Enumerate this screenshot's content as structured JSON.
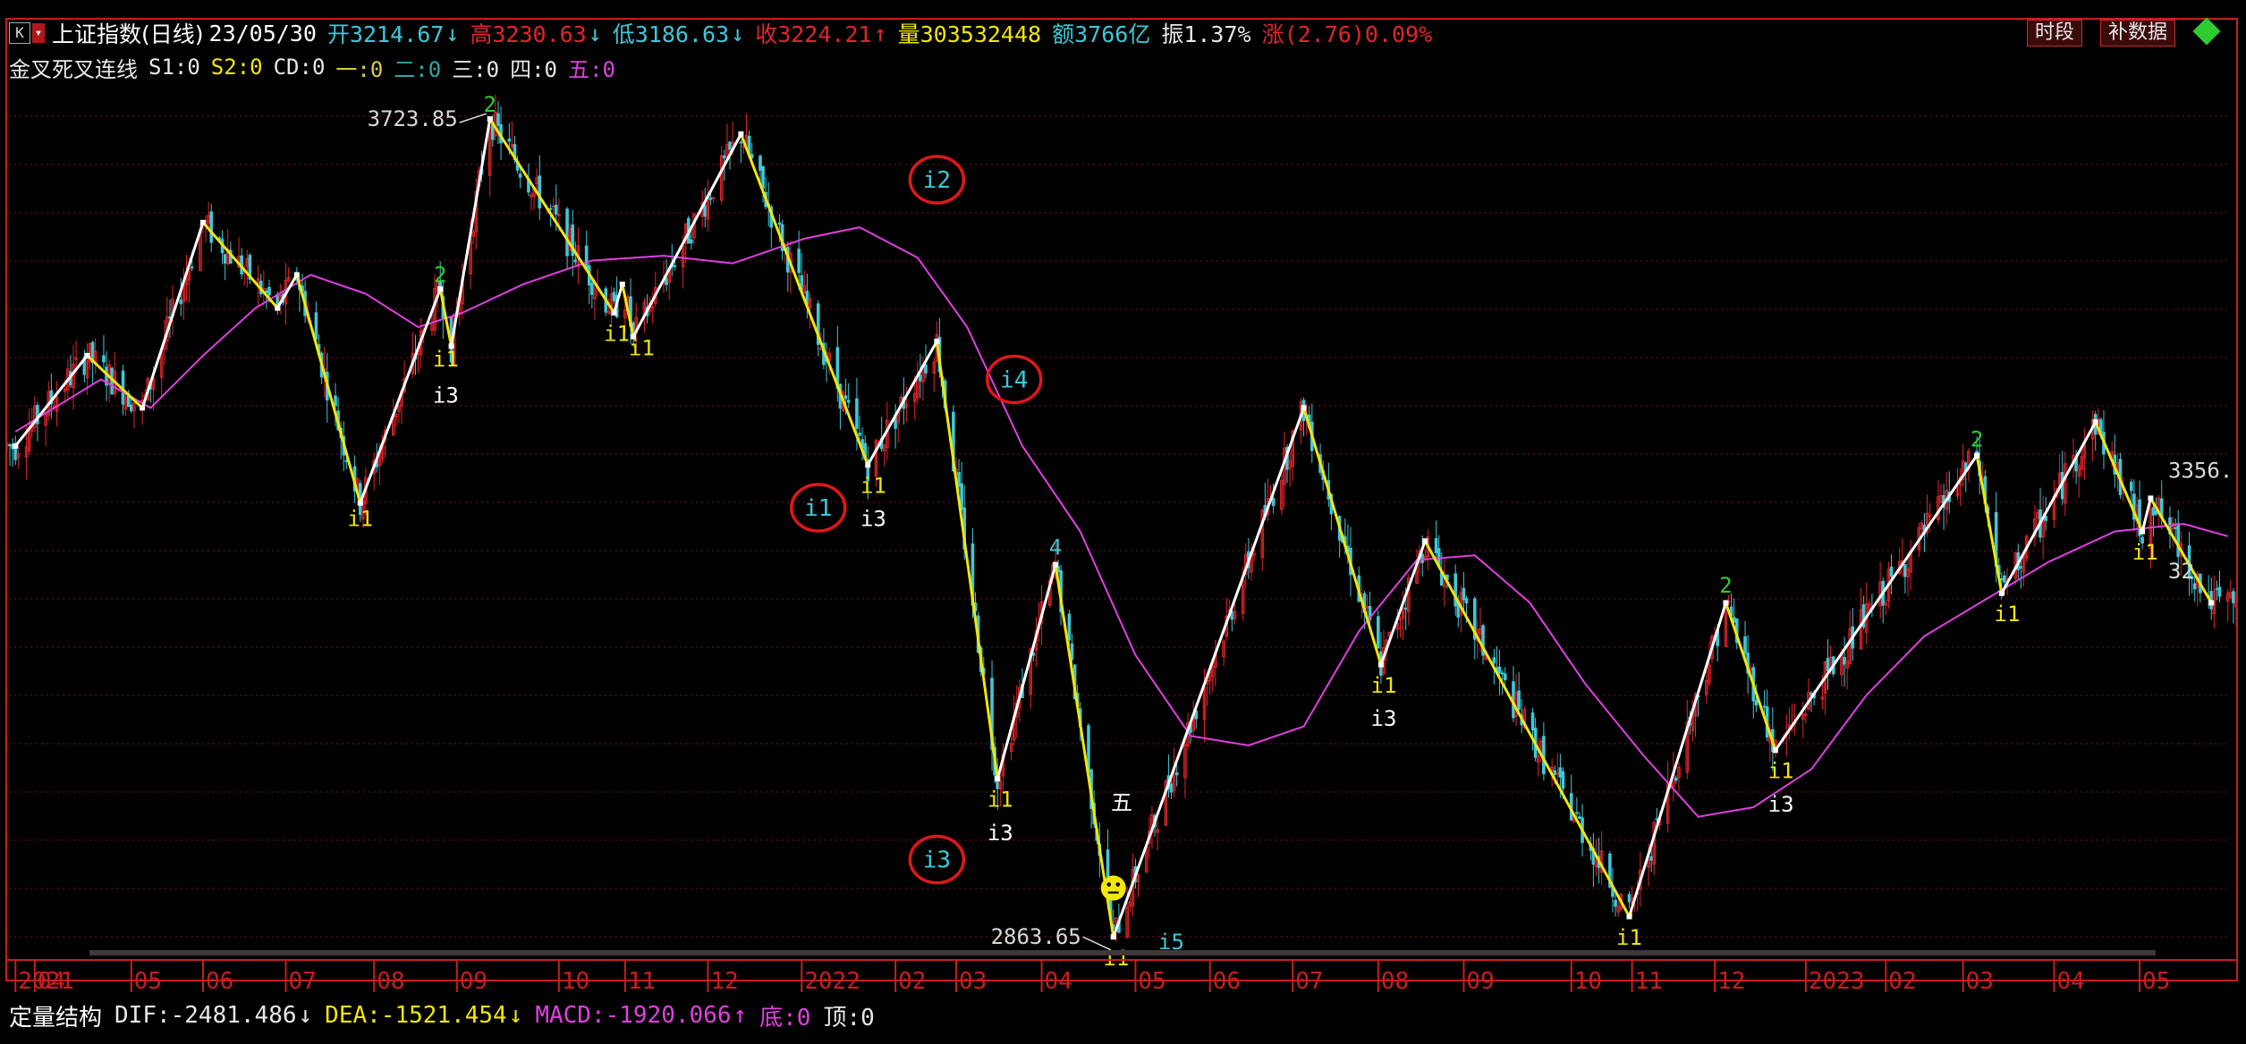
{
  "header": {
    "k_button": "K",
    "menu_button": "▾",
    "title": "上证指数(日线)",
    "date": "23/05/30",
    "open": "开3214.67",
    "open_arrow": "↓",
    "high": "高3230.63",
    "high_arrow": "↓",
    "low": "低3186.63",
    "low_arrow": "↓",
    "close": "收3224.21",
    "close_arrow": "↑",
    "volume": "量303532448",
    "amount": "额3766亿",
    "amplitude": "振1.37%",
    "change": "涨(2.76)0.09%"
  },
  "buttons": {
    "segment": "时段",
    "supplement": "补数据"
  },
  "indicator": {
    "name": "金叉死叉连线",
    "s1": "S1:0",
    "s2": "S2:0",
    "cd": "CD:0",
    "one": "一:0",
    "two": "二:0",
    "three": "三:0",
    "four": "四:0",
    "five": "五:0"
  },
  "footer": {
    "name": "定量结构",
    "dif": "DIF:-2481.486",
    "dif_arrow": "↓",
    "dea": "DEA:-1521.454",
    "dea_arrow": "↓",
    "macd": "MACD:-1920.066",
    "macd_arrow": "↑",
    "bottom": "底:0",
    "top": "顶:0"
  },
  "colors": {
    "up": "#e0262b",
    "down": "#3ec8d8",
    "zigzag_white": "#ffffff",
    "zigzag_yellow": "#f2e60c",
    "ma": "#e040e0",
    "grid": "#8a1010",
    "axis": "#c81e1e",
    "annotation": "#e0161c"
  },
  "chart_data": {
    "type": "line",
    "subtype": "candlestick-with-zigzag",
    "title": "上证指数(日线)",
    "x_axis_labels": [
      {
        "label": "2021",
        "date": "2021-03-25"
      },
      {
        "label": "04",
        "date": "2021-04-01"
      },
      {
        "label": "05",
        "date": "2021-05-06"
      },
      {
        "label": "06",
        "date": "2021-06-01"
      },
      {
        "label": "07",
        "date": "2021-07-01"
      },
      {
        "label": "08",
        "date": "2021-08-02"
      },
      {
        "label": "09",
        "date": "2021-09-01"
      },
      {
        "label": "10",
        "date": "2021-10-08"
      },
      {
        "label": "11",
        "date": "2021-11-01"
      },
      {
        "label": "12",
        "date": "2021-12-01"
      },
      {
        "label": "2022",
        "date": "2022-01-04"
      },
      {
        "label": "02",
        "date": "2022-02-07"
      },
      {
        "label": "03",
        "date": "2022-03-01"
      },
      {
        "label": "04",
        "date": "2022-04-01"
      },
      {
        "label": "05",
        "date": "2022-05-05"
      },
      {
        "label": "06",
        "date": "2022-06-01"
      },
      {
        "label": "07",
        "date": "2022-07-01"
      },
      {
        "label": "08",
        "date": "2022-08-01"
      },
      {
        "label": "09",
        "date": "2022-09-01"
      },
      {
        "label": "10",
        "date": "2022-10-10"
      },
      {
        "label": "11",
        "date": "2022-11-01"
      },
      {
        "label": "12",
        "date": "2022-12-01"
      },
      {
        "label": "2023",
        "date": "2023-01-03"
      },
      {
        "label": "02",
        "date": "2023-02-01"
      },
      {
        "label": "03",
        "date": "2023-03-01"
      },
      {
        "label": "04",
        "date": "2023-04-03"
      },
      {
        "label": "05",
        "date": "2023-05-04"
      }
    ],
    "x_range": [
      "2021-03-22",
      "2023-06-08"
    ],
    "y_range": [
      2845,
      3755
    ],
    "price_labels": [
      {
        "label": "3723.85",
        "date": "2021-09-13",
        "value": 3723.85
      },
      {
        "label": "2863.65",
        "date": "2022-04-27",
        "value": 2863.65
      },
      {
        "label": "3356.",
        "date": "2023-05-31",
        "value": 3356
      },
      {
        "label": "32",
        "date": "2023-06-06",
        "value": 3250
      }
    ],
    "zigzag": [
      {
        "date": "2021-03-25",
        "value": 3380,
        "color": "white"
      },
      {
        "date": "2021-04-20",
        "value": 3475,
        "color": "yellow"
      },
      {
        "date": "2021-05-10",
        "value": 3420,
        "color": "white"
      },
      {
        "date": "2021-06-01",
        "value": 3615,
        "color": "yellow"
      },
      {
        "date": "2021-06-28",
        "value": 3525,
        "color": "white"
      },
      {
        "date": "2021-07-05",
        "value": 3560,
        "color": "yellow"
      },
      {
        "date": "2021-07-28",
        "value": 3320,
        "color": "white"
      },
      {
        "date": "2021-08-26",
        "value": 3545,
        "color": "yellow"
      },
      {
        "date": "2021-08-30",
        "value": 3485,
        "color": "white"
      },
      {
        "date": "2021-09-13",
        "value": 3723.85,
        "color": "yellow"
      },
      {
        "date": "2021-10-28",
        "value": 3520,
        "color": "white"
      },
      {
        "date": "2021-10-31",
        "value": 3550,
        "color": "yellow"
      },
      {
        "date": "2021-11-04",
        "value": 3495,
        "color": "white"
      },
      {
        "date": "2021-12-13",
        "value": 3708,
        "color": "yellow"
      },
      {
        "date": "2022-01-28",
        "value": 3360,
        "color": "white"
      },
      {
        "date": "2022-02-22",
        "value": 3490,
        "color": "yellow"
      },
      {
        "date": "2022-03-16",
        "value": 3030,
        "color": "white"
      },
      {
        "date": "2022-04-06",
        "value": 3255,
        "color": "yellow"
      },
      {
        "date": "2022-04-27",
        "value": 2863.65,
        "color": "white"
      },
      {
        "date": "2022-07-05",
        "value": 3420,
        "color": "yellow"
      },
      {
        "date": "2022-08-02",
        "value": 3150,
        "color": "white"
      },
      {
        "date": "2022-08-18",
        "value": 3280,
        "color": "yellow"
      },
      {
        "date": "2022-10-31",
        "value": 2885,
        "color": "white"
      },
      {
        "date": "2022-12-05",
        "value": 3215,
        "color": "yellow"
      },
      {
        "date": "2022-12-23",
        "value": 3060,
        "color": "white"
      },
      {
        "date": "2023-03-06",
        "value": 3370,
        "color": "yellow"
      },
      {
        "date": "2023-03-15",
        "value": 3225,
        "color": "white"
      },
      {
        "date": "2023-04-18",
        "value": 3405,
        "color": "yellow"
      },
      {
        "date": "2023-05-05",
        "value": 3290,
        "color": "white"
      },
      {
        "date": "2023-05-08",
        "value": 3325,
        "color": "yellow"
      },
      {
        "date": "2023-05-30",
        "value": 3215,
        "color": "yellow"
      }
    ],
    "moving_average": [
      {
        "date": "2021-03-25",
        "value": 3395
      },
      {
        "date": "2021-04-25",
        "value": 3450
      },
      {
        "date": "2021-05-13",
        "value": 3420
      },
      {
        "date": "2021-06-01",
        "value": 3475
      },
      {
        "date": "2021-06-20",
        "value": 3525
      },
      {
        "date": "2021-07-10",
        "value": 3560
      },
      {
        "date": "2021-07-30",
        "value": 3540
      },
      {
        "date": "2021-08-18",
        "value": 3505
      },
      {
        "date": "2021-09-03",
        "value": 3520
      },
      {
        "date": "2021-09-25",
        "value": 3550
      },
      {
        "date": "2021-10-20",
        "value": 3575
      },
      {
        "date": "2021-11-15",
        "value": 3580
      },
      {
        "date": "2021-12-10",
        "value": 3572
      },
      {
        "date": "2022-01-05",
        "value": 3598
      },
      {
        "date": "2022-01-25",
        "value": 3610
      },
      {
        "date": "2022-02-15",
        "value": 3578
      },
      {
        "date": "2022-03-05",
        "value": 3505
      },
      {
        "date": "2022-03-25",
        "value": 3380
      },
      {
        "date": "2022-04-15",
        "value": 3290
      },
      {
        "date": "2022-05-05",
        "value": 3160
      },
      {
        "date": "2022-05-25",
        "value": 3075
      },
      {
        "date": "2022-06-15",
        "value": 3065
      },
      {
        "date": "2022-07-05",
        "value": 3085
      },
      {
        "date": "2022-07-25",
        "value": 3185
      },
      {
        "date": "2022-08-15",
        "value": 3260
      },
      {
        "date": "2022-09-05",
        "value": 3265
      },
      {
        "date": "2022-09-25",
        "value": 3215
      },
      {
        "date": "2022-10-15",
        "value": 3130
      },
      {
        "date": "2022-11-05",
        "value": 3055
      },
      {
        "date": "2022-11-25",
        "value": 2990
      },
      {
        "date": "2022-12-15",
        "value": 3000
      },
      {
        "date": "2023-01-05",
        "value": 3040
      },
      {
        "date": "2023-01-25",
        "value": 3118
      },
      {
        "date": "2023-02-15",
        "value": 3180
      },
      {
        "date": "2023-03-10",
        "value": 3220
      },
      {
        "date": "2023-04-01",
        "value": 3258
      },
      {
        "date": "2023-04-25",
        "value": 3290
      },
      {
        "date": "2023-05-20",
        "value": 3298
      },
      {
        "date": "2023-06-05",
        "value": 3285
      }
    ],
    "labels": [
      {
        "text": "2",
        "date": "2021-09-13",
        "value": 3723.85,
        "pos": "above",
        "color": "#33cc33"
      },
      {
        "text": "2",
        "date": "2021-08-26",
        "value": 3545,
        "pos": "above",
        "color": "#33cc33"
      },
      {
        "text": "i1",
        "date": "2021-08-28",
        "value": 3488,
        "pos": "below",
        "color": "#f2e60c"
      },
      {
        "text": "i3",
        "date": "2021-08-28",
        "value": 3450,
        "pos": "below",
        "color": "#ffffff"
      },
      {
        "text": "i1",
        "date": "2021-07-28",
        "value": 3320,
        "pos": "below",
        "color": "#f2e60c"
      },
      {
        "text": "i1",
        "date": "2021-10-29",
        "value": 3515,
        "pos": "below",
        "color": "#f2e60c"
      },
      {
        "text": "i1",
        "date": "2021-11-07",
        "value": 3500,
        "pos": "below",
        "color": "#f2e60c"
      },
      {
        "text": "i1",
        "date": "2022-01-30",
        "value": 3355,
        "pos": "below",
        "color": "#f2e60c"
      },
      {
        "text": "i3",
        "date": "2022-01-30",
        "value": 3320,
        "pos": "below",
        "color": "#ffffff"
      },
      {
        "text": "i1",
        "date": "2022-03-17",
        "value": 3025,
        "pos": "below",
        "color": "#f2e60c"
      },
      {
        "text": "i3",
        "date": "2022-03-17",
        "value": 2990,
        "pos": "below",
        "color": "#ffffff"
      },
      {
        "text": "4",
        "date": "2022-04-06",
        "value": 3258,
        "pos": "above",
        "color": "#3ec8d8"
      },
      {
        "text": "五",
        "date": "2022-04-30",
        "value": 2990,
        "pos": "above",
        "color": "#ffffff"
      },
      {
        "text": "i1",
        "date": "2022-04-28",
        "value": 2858,
        "pos": "below",
        "color": "#f2e60c"
      },
      {
        "text": "i5",
        "date": "2022-05-18",
        "value": 2875,
        "pos": "below",
        "color": "#3ec8d8"
      },
      {
        "text": "i1",
        "date": "2022-08-03",
        "value": 3145,
        "pos": "below",
        "color": "#f2e60c"
      },
      {
        "text": "i3",
        "date": "2022-08-03",
        "value": 3110,
        "pos": "below",
        "color": "#ffffff"
      },
      {
        "text": "i1",
        "date": "2022-10-31",
        "value": 2880,
        "pos": "below",
        "color": "#f2e60c"
      },
      {
        "text": "2",
        "date": "2022-12-05",
        "value": 3218,
        "pos": "above",
        "color": "#33cc33"
      },
      {
        "text": "i1",
        "date": "2022-12-25",
        "value": 3055,
        "pos": "below",
        "color": "#f2e60c"
      },
      {
        "text": "i3",
        "date": "2022-12-25",
        "value": 3020,
        "pos": "below",
        "color": "#ffffff"
      },
      {
        "text": "2",
        "date": "2023-03-06",
        "value": 3372,
        "pos": "above",
        "color": "#33cc33"
      },
      {
        "text": "i1",
        "date": "2023-03-17",
        "value": 3220,
        "pos": "below",
        "color": "#f2e60c"
      },
      {
        "text": "i1",
        "date": "2023-05-06",
        "value": 3285,
        "pos": "below",
        "color": "#f2e60c"
      }
    ],
    "annotations": [
      {
        "text": "i2",
        "date": "2022-02-22",
        "value": 3660
      },
      {
        "text": "i4",
        "date": "2022-03-22",
        "value": 3450
      },
      {
        "text": "i1",
        "date": "2022-01-10",
        "value": 3315
      },
      {
        "text": "i3",
        "date": "2022-02-22",
        "value": 2945
      }
    ],
    "marker": {
      "date": "2022-04-27",
      "value": 2915,
      "shape": "smiley",
      "color": "#f2e60c"
    },
    "grid": true,
    "legend": "none"
  }
}
